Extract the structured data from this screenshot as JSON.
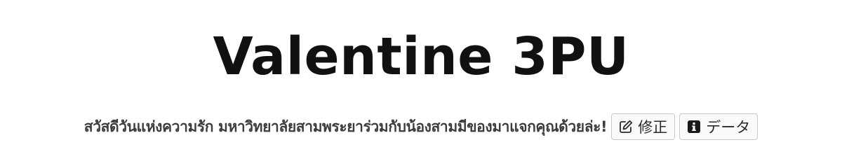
{
  "header": {
    "title": "Valentine 3PU"
  },
  "description": {
    "text": "สวัสดีวันแห่งความรัก มหาวิทยาลัยสามพระยาร่วมกับน้องสามมีของมาแจกคุณด้วยล่ะ!"
  },
  "actions": {
    "edit_label": "修正",
    "edit_icon": "edit-icon",
    "data_label": "データ",
    "data_icon": "info-icon"
  },
  "colors": {
    "title": "#111111",
    "text": "#3c3c3c",
    "button_border": "#c9c9c9"
  }
}
